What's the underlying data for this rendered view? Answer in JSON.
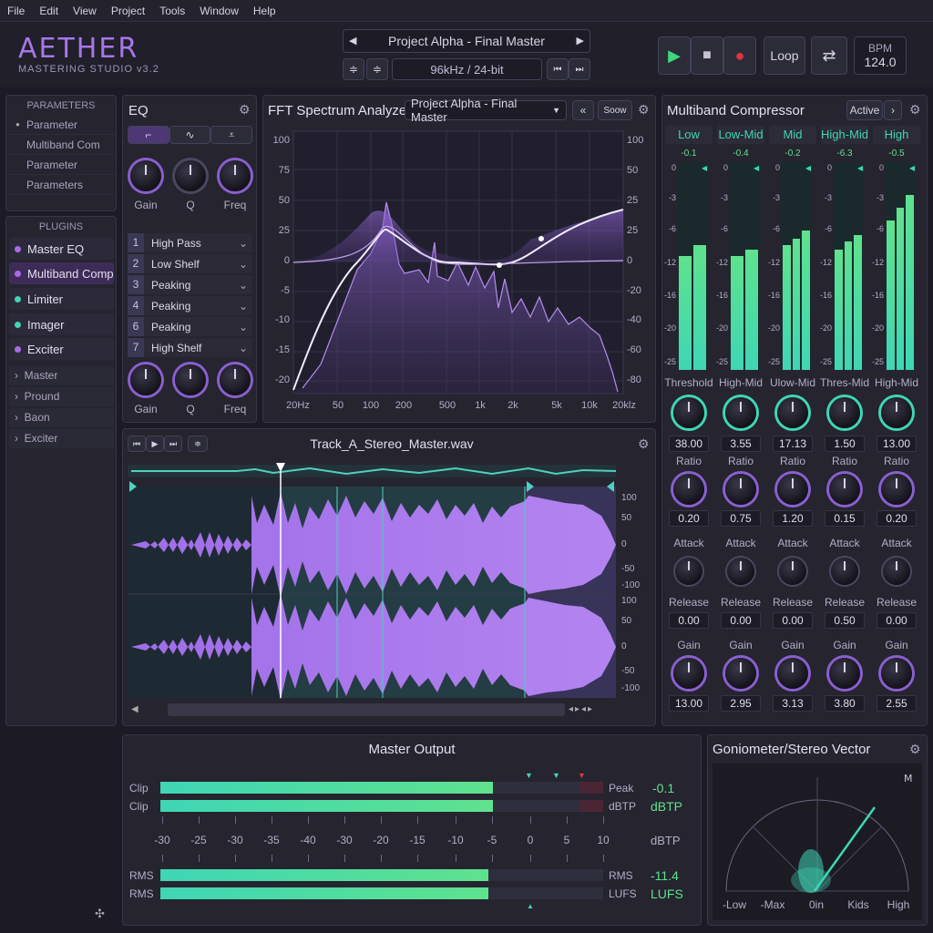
{
  "menu": [
    "File",
    "Edit",
    "View",
    "Project",
    "Tools",
    "Window",
    "Help"
  ],
  "app": {
    "name": "AETHER",
    "subtitle": "MASTERING STUDIO v3.2"
  },
  "transport": {
    "project": "Project Alpha - Final Master",
    "format": "96kHz / 24-bit",
    "loop_label": "Loop",
    "bpm_label": "BPM",
    "bpm_value": "124.0"
  },
  "parameters": {
    "title": "PARAMETERS",
    "items": [
      "Parameter",
      "Multiband Com",
      "Parameter",
      "Parameters"
    ]
  },
  "plugins": {
    "title": "PLUGINS",
    "items": [
      {
        "label": "Master EQ",
        "color": "#a86be8"
      },
      {
        "label": "Multiband Comp",
        "color": "#a86be8"
      },
      {
        "label": "Limiter",
        "color": "#3fd6b5"
      },
      {
        "label": "Imager",
        "color": "#3fd6b5"
      },
      {
        "label": "Exciter",
        "color": "#a86be8"
      }
    ],
    "nodes": [
      "Master",
      "Pround",
      "Baon",
      "Exciter"
    ]
  },
  "eq": {
    "title": "EQ",
    "knobs_top": [
      "Gain",
      "Q",
      "Freq"
    ],
    "knobs_bottom": [
      "Gain",
      "Q",
      "Freq"
    ],
    "bands": [
      {
        "num": "1",
        "label": "High Pass"
      },
      {
        "num": "2",
        "label": "Low Shelf"
      },
      {
        "num": "3",
        "label": "Peaking"
      },
      {
        "num": "4",
        "label": "Peaking"
      },
      {
        "num": "6",
        "label": "Peaking"
      },
      {
        "num": "7",
        "label": "High Shelf"
      }
    ]
  },
  "analyzer": {
    "title": "FFT Spectrum Analyzer",
    "preset": "Project Alpha - Final Master",
    "speed": "Soow",
    "y_left": [
      "100",
      "75",
      "50",
      "25",
      "0",
      "-5",
      "-10",
      "-15",
      "-20"
    ],
    "y_right": [
      "100",
      "50",
      "25",
      "0",
      "-20",
      "-40",
      "-60",
      "-80"
    ],
    "x_labels": [
      "20Hz",
      "50",
      "100",
      "200",
      "500",
      "1k",
      "2k",
      "5k",
      "10k",
      "20klz"
    ]
  },
  "waveform": {
    "filename": "Track_A_Stereo_Master.wav",
    "scale_top": [
      "100",
      "50",
      "0",
      "-50",
      "-100"
    ],
    "scale_bottom": [
      "100",
      "50",
      "0",
      "-50",
      "-100"
    ]
  },
  "compressor": {
    "title": "Multiband Compressor",
    "status": "Active",
    "scale": [
      "0",
      "-3",
      "-6",
      "-12",
      "-16",
      "-20",
      "-25"
    ],
    "bands": [
      {
        "name": "Low",
        "peak": "-0.1",
        "threshold_label": "Threshold",
        "threshold": "38.00",
        "ratio": "0.20",
        "release": "0.00",
        "gain": "13.00",
        "levels": [
          0.55,
          0.6
        ]
      },
      {
        "name": "Low-Mid",
        "peak": "-0.4",
        "threshold_label": "High-Mid",
        "threshold": "3.55",
        "ratio": "0.75",
        "release": "0.00",
        "gain": "2.95",
        "levels": [
          0.55,
          0.58
        ]
      },
      {
        "name": "Mid",
        "peak": "-0.2",
        "threshold_label": "Ulow-Mid",
        "threshold": "17.13",
        "ratio": "1.20",
        "release": "0.00",
        "gain": "3.13",
        "levels": [
          0.6,
          0.63,
          0.67
        ]
      },
      {
        "name": "High-Mid",
        "peak": "-6.3",
        "threshold_label": "Thres-Mid",
        "threshold": "1.50",
        "ratio": "0.15",
        "release": "0.50",
        "gain": "3.80",
        "levels": [
          0.58,
          0.62,
          0.65
        ]
      },
      {
        "name": "High",
        "peak": "-0.5",
        "threshold_label": "High-Mid",
        "threshold": "13.00",
        "ratio": "0.20",
        "release": "0.00",
        "gain": "2.55",
        "levels": [
          0.72,
          0.78,
          0.84
        ]
      }
    ],
    "ratio_label": "Ratio",
    "attack_label": "Attack",
    "release_label": "Release",
    "gain_label": "Gain"
  },
  "master_output": {
    "title": "Master Output",
    "clip_label": "Clip",
    "rms_label": "RMS",
    "peak_label": "Peak",
    "dbtp_label": "dBTP",
    "lufs_label": "LUFS",
    "peak_value": "-0.1",
    "peak_unit": "dBTP",
    "rms_value": "-11.4",
    "rms_unit": "LUFS",
    "scale_unit": "dBTP",
    "scale": [
      "-30",
      "-25",
      "-30",
      "-35",
      "-40",
      "-30",
      "-20",
      "-15",
      "-10",
      "-5",
      "0",
      "5",
      "10"
    ],
    "peak_level": 0.75,
    "rms_level": 0.74
  },
  "goniometer": {
    "title": "Goniometer/Stereo Vector",
    "labels": [
      "-Low",
      "-Max",
      "0in",
      "Kids",
      "High"
    ]
  },
  "colors": {
    "accent": "#a86be8",
    "teal": "#3fd6b5",
    "meter_green": "#5fe28e"
  }
}
